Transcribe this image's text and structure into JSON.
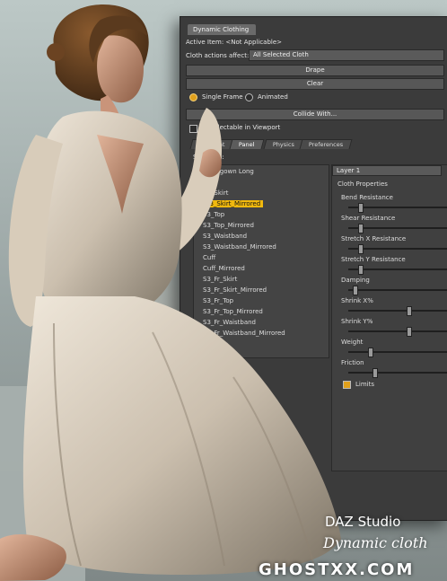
{
  "dialog": {
    "title": "Dynamic Clothing",
    "active_item_label": "Active Item: <Not Applicable>",
    "cloth_actions_label": "Cloth actions affect:",
    "cloth_actions_value": "All Selected Cloth",
    "drape_label": "Drape",
    "clear_label": "Clear",
    "single_frame_label": "Single Frame",
    "animated_label": "Animated",
    "collide_label": "Collide With...",
    "all_selectable_label": "All Selectable in Viewport"
  },
  "tabs": [
    "Garment",
    "Panel",
    "Physics",
    "Preferences"
  ],
  "tree": {
    "header": "Selection:",
    "items": [
      "Nightgown Long",
      "S3_Skirt",
      "S3_Skirt_Mirrored",
      "S3_Top",
      "S3_Top_Mirrored",
      "S3_Waistband",
      "S3_Waistband_Mirrored",
      "Cuff",
      "Cuff_Mirrored",
      "S3_Fr_Skirt",
      "S3_Fr_Skirt_Mirrored",
      "S3_Fr_Top",
      "S3_Fr_Top_Mirrored",
      "S3_Fr_Waistband",
      "S3_Fr_Waistband_Mirrored"
    ]
  },
  "props": {
    "layer": "Layer 1",
    "section": "Cloth Properties",
    "properties": [
      {
        "label": "Bend Resistance",
        "value": 0.1
      },
      {
        "label": "Shear Resistance",
        "value": 0.1
      },
      {
        "label": "Stretch X Resistance",
        "value": 0.1
      },
      {
        "label": "Stretch Y Resistance",
        "value": 0.1
      },
      {
        "label": "Damping",
        "value": 0.05
      },
      {
        "label": "Shrink X%",
        "value": 0.6
      },
      {
        "label": "Shrink Y%",
        "value": 0.6
      },
      {
        "label": "Weight",
        "value": 0.2
      },
      {
        "label": "Friction",
        "value": 0.25
      }
    ],
    "limits_label": "Limits"
  },
  "branding": {
    "product": "DAZ Studio",
    "subtitle": "Dynamic cloth",
    "watermark": "GHOSTXX.COM"
  }
}
